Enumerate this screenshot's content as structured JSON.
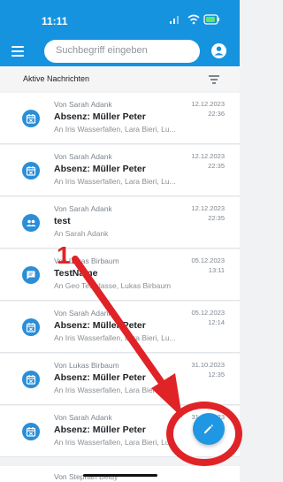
{
  "status": {
    "time": "11:11"
  },
  "header": {
    "search_placeholder": "Suchbegriff eingeben"
  },
  "section": {
    "title": "Aktive Nachrichten"
  },
  "messages": [
    {
      "from": "Von Sarah Adank",
      "title": "Absenz: Müller Peter",
      "to": "An Iris Wasserfallen, Lara Bieri, Lu...",
      "date": "12.12.2023",
      "time": "22:36",
      "icon": "calendar-icon"
    },
    {
      "from": "Von Sarah Adank",
      "title": "Absenz: Müller Peter",
      "to": "An Iris Wasserfallen, Lara Bieri, Lu...",
      "date": "12.12.2023",
      "time": "22:35",
      "icon": "calendar-icon"
    },
    {
      "from": "Von Sarah Adank",
      "title": "test",
      "to": "An Sarah Adank",
      "date": "12.12.2023",
      "time": "22:35",
      "icon": "group-icon"
    },
    {
      "from": "Von Lukas Birbaum",
      "title": "TestName",
      "to": "An Geo Testklasse, Lukas Birbaum",
      "date": "05.12.2023",
      "time": "13:11",
      "icon": "chat-icon"
    },
    {
      "from": "Von Sarah Adank",
      "title": "Absenz: Müller Peter",
      "to": "An Iris Wasserfallen, Lara Bieri, Lu...",
      "date": "05.12.2023",
      "time": "12:14",
      "icon": "calendar-icon"
    },
    {
      "from": "Von Lukas Birbaum",
      "title": "Absenz: Müller Peter",
      "to": "An Iris Wasserfallen, Lara Bieri, Na...",
      "date": "31.10.2023",
      "time": "12:35",
      "icon": "calendar-icon"
    },
    {
      "from": "Von Sarah Adank",
      "title": "Absenz: Müller Peter",
      "to": "An Iris Wasserfallen, Lara Bieri, Lu...",
      "date": "31.10.2023",
      "time": "",
      "icon": "calendar-icon"
    }
  ],
  "partial_row": {
    "from": "Von Stephan Beldy"
  },
  "annotation": {
    "label": "1."
  },
  "colors": {
    "brand": "#1693df",
    "fab": "#1f97e3",
    "annotation": "#e02327"
  }
}
